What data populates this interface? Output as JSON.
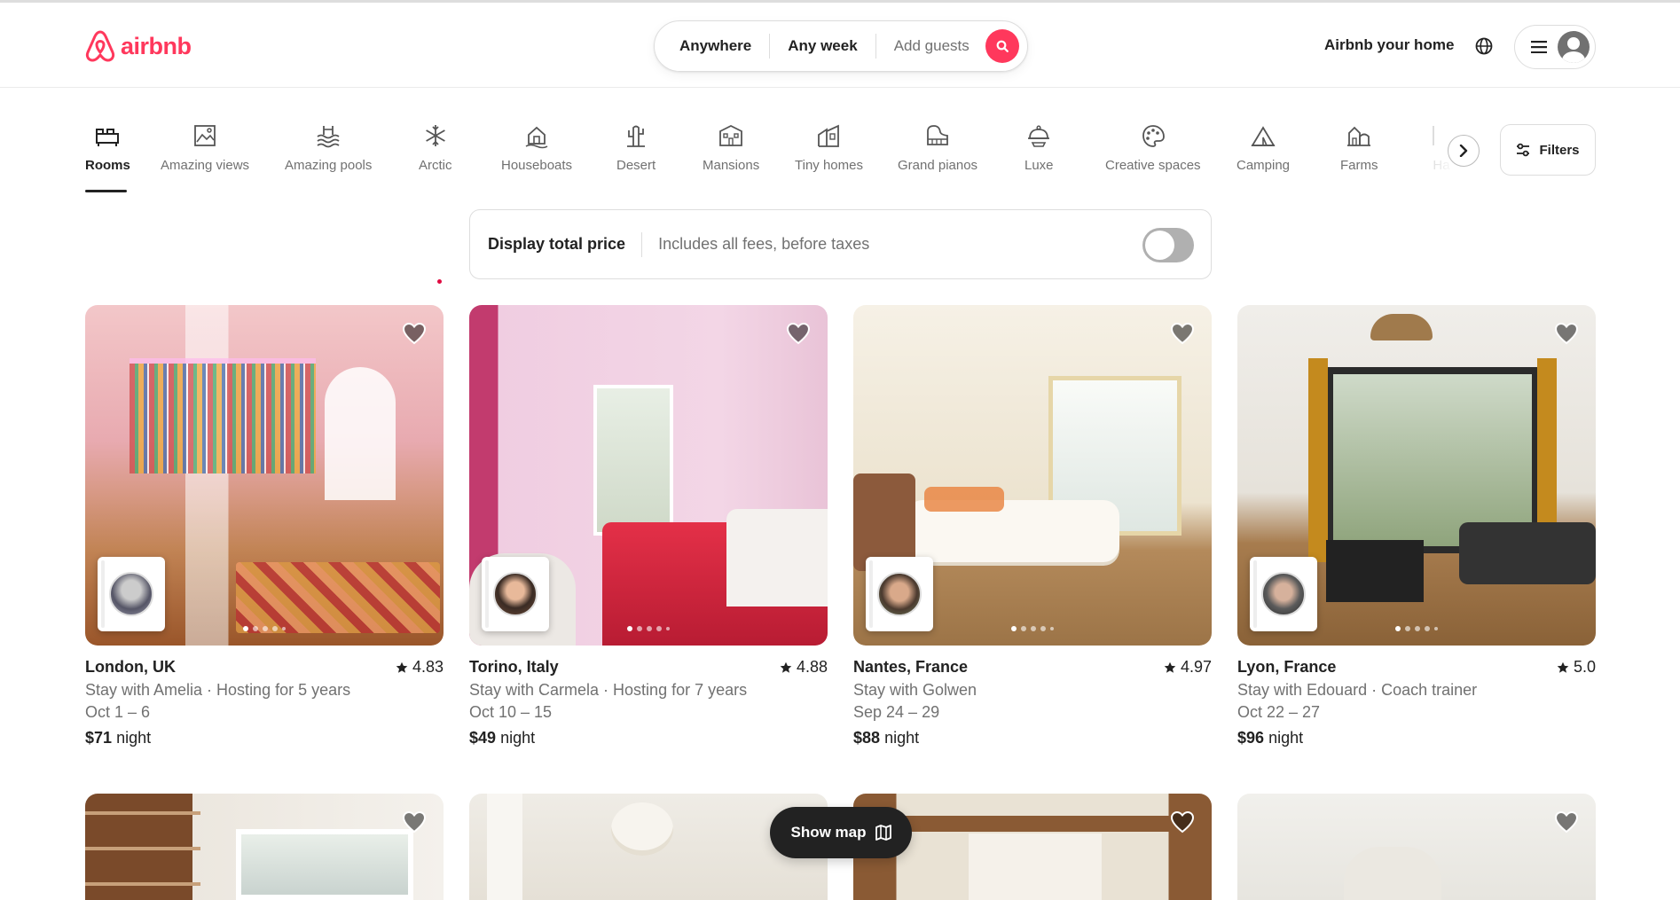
{
  "brand": {
    "name": "airbnb",
    "color": "#ff385c"
  },
  "search": {
    "location": "Anywhere",
    "dates": "Any week",
    "guests_placeholder": "Add guests"
  },
  "header": {
    "host_link": "Airbnb your home"
  },
  "categories": [
    {
      "label": "Rooms",
      "icon": "rooms-icon",
      "active": true
    },
    {
      "label": "Amazing views",
      "icon": "views-icon"
    },
    {
      "label": "Amazing pools",
      "icon": "pools-icon"
    },
    {
      "label": "Arctic",
      "icon": "snowflake-icon"
    },
    {
      "label": "Houseboats",
      "icon": "houseboat-icon"
    },
    {
      "label": "Desert",
      "icon": "cactus-icon"
    },
    {
      "label": "Mansions",
      "icon": "mansion-icon"
    },
    {
      "label": "Tiny homes",
      "icon": "tiny-home-icon"
    },
    {
      "label": "Grand pianos",
      "icon": "piano-icon"
    },
    {
      "label": "Luxe",
      "icon": "luxe-icon"
    },
    {
      "label": "Creative spaces",
      "icon": "palette-icon"
    },
    {
      "label": "Camping",
      "icon": "tent-icon"
    },
    {
      "label": "Farms",
      "icon": "farm-icon"
    },
    {
      "label": "Ha",
      "icon": "partial-icon"
    }
  ],
  "filters": {
    "label": "Filters"
  },
  "price_toggle": {
    "title": "Display total price",
    "subtitle": "Includes all fees, before taxes",
    "enabled": false
  },
  "listings": [
    {
      "location": "London, UK",
      "rating": "4.83",
      "subtitle": "Stay with Amelia · Hosting for 5 years",
      "dates": "Oct 1 – 6",
      "price": "$71",
      "price_unit": "night"
    },
    {
      "location": "Torino, Italy",
      "rating": "4.88",
      "subtitle": "Stay with Carmela · Hosting for 7 years",
      "dates": "Oct 10 – 15",
      "price": "$49",
      "price_unit": "night"
    },
    {
      "location": "Nantes, France",
      "rating": "4.97",
      "subtitle": "Stay with Golwen",
      "dates": "Sep 24 – 29",
      "price": "$88",
      "price_unit": "night"
    },
    {
      "location": "Lyon, France",
      "rating": "5.0",
      "subtitle": "Stay with Edouard · Coach trainer",
      "dates": "Oct 22 – 27",
      "price": "$96",
      "price_unit": "night"
    }
  ],
  "show_map": {
    "label": "Show map"
  }
}
